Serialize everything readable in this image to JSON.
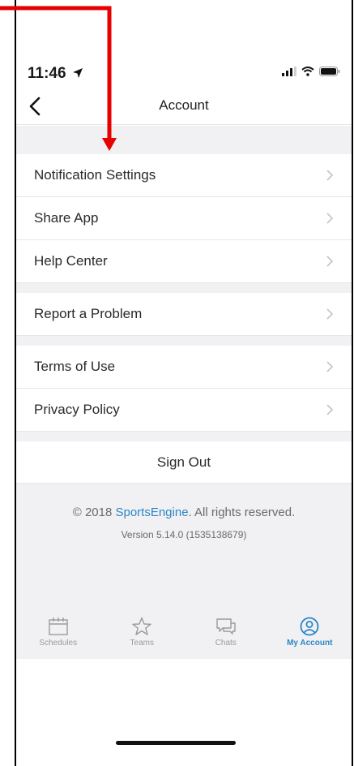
{
  "status_bar": {
    "time": "11:46"
  },
  "header": {
    "title": "Account"
  },
  "groups": [
    {
      "items": [
        {
          "label": "Notification Settings"
        },
        {
          "label": "Share App"
        },
        {
          "label": "Help Center"
        }
      ]
    },
    {
      "items": [
        {
          "label": "Report a Problem"
        }
      ]
    },
    {
      "items": [
        {
          "label": "Terms of Use"
        },
        {
          "label": "Privacy Policy"
        }
      ]
    }
  ],
  "sign_out": {
    "label": "Sign Out"
  },
  "footer": {
    "copyright_prefix": "© 2018 ",
    "brand": "SportsEngine",
    "copyright_suffix": ". All rights reserved.",
    "version": "Version 5.14.0 (1535138679)"
  },
  "tabs": [
    {
      "label": "Schedules",
      "icon": "calendar-icon"
    },
    {
      "label": "Teams",
      "icon": "star-icon"
    },
    {
      "label": "Chats",
      "icon": "chat-icon"
    },
    {
      "label": "My Account",
      "icon": "account-icon",
      "active": true
    }
  ],
  "colors": {
    "accent": "#2c86c6",
    "annotation": "#e60000",
    "group_background": "#f1f1f3"
  }
}
